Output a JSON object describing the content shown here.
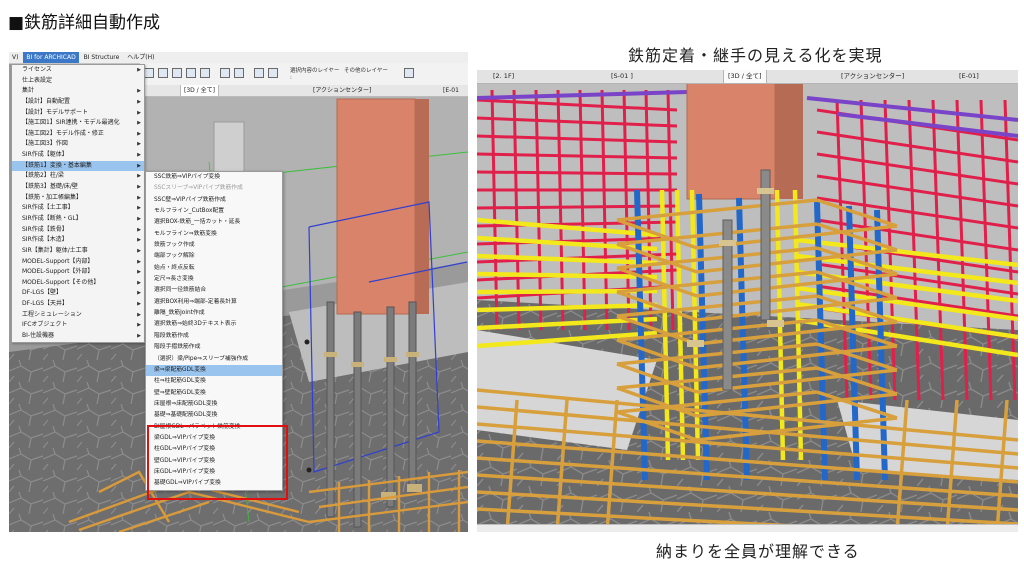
{
  "page": {
    "title": "■鉄筋詳細自動作成",
    "caption_top": "鉄筋定着・継手の見える化を実現",
    "caption_bottom": "納まりを全員が理解できる"
  },
  "left": {
    "menubar": [
      {
        "label": "V)"
      },
      {
        "label": "BI for ARCHICAD",
        "active": true
      },
      {
        "label": "BI Structure"
      },
      {
        "label": "ヘルプ(H)"
      }
    ],
    "toolbar": {
      "label1": "選択内容のレイヤー",
      "label2": "その他のレイヤー",
      "label3": ":"
    },
    "tabs": [
      {
        "label": "[3D / 全て]"
      },
      {
        "label": "[アクションセンター]"
      },
      {
        "label": "[E-01"
      }
    ],
    "menu": [
      {
        "label": "ライセンス",
        "arrow": true
      },
      {
        "label": "仕上表設定",
        "arrow": false
      },
      {
        "label": "集計",
        "arrow": true
      },
      {
        "label": "【設計】自動配置",
        "arrow": true
      },
      {
        "label": "【設計】モデルサポート",
        "arrow": true
      },
      {
        "label": "【施工図1】SIR連携・モデル最適化",
        "arrow": true
      },
      {
        "label": "【施工図2】モデル作成・修正",
        "arrow": true
      },
      {
        "label": "【施工図3】作図",
        "arrow": true
      },
      {
        "label": "SIR作成【躯体】",
        "arrow": true
      },
      {
        "label": "【鉄筋1】変換・基本編集",
        "arrow": true,
        "highlight": true
      },
      {
        "label": "【鉄筋2】柱/梁",
        "arrow": true
      },
      {
        "label": "【鉄筋3】基礎/床/壁",
        "arrow": true
      },
      {
        "label": "【鉄筋・加工帳編集】",
        "arrow": true
      },
      {
        "label": "SIR作成【土工事】",
        "arrow": true
      },
      {
        "label": "SIR作成【断熱・GL】",
        "arrow": true
      },
      {
        "label": "SIR作成【鉄骨】",
        "arrow": true
      },
      {
        "label": "SIR作成【木造】",
        "arrow": true
      },
      {
        "label": "SIR【集計】躯体/土工事",
        "arrow": true
      },
      {
        "label": "MODEL-Support【内部】",
        "arrow": true
      },
      {
        "label": "MODEL-Support【外部】",
        "arrow": true
      },
      {
        "label": "MODEL-Support【その他】",
        "arrow": true
      },
      {
        "label": "DF-LGS【壁】",
        "arrow": true
      },
      {
        "label": "DF-LGS【天井】",
        "arrow": true
      },
      {
        "label": "工程シミュレーション",
        "arrow": true
      },
      {
        "label": "IFCオブジェクト",
        "arrow": true
      },
      {
        "label": "BI-住設機器",
        "arrow": true
      }
    ],
    "submenu": [
      {
        "label": "SSC鉄筋⇒VIPパイプ変換"
      },
      {
        "label": "SSCスリーブ⇒VIPパイプ鉄筋作成",
        "dim": true
      },
      {
        "label": "SSC壁⇒VIPパイプ鉄筋作成"
      },
      {
        "label": "モルフライン_CutBox配置"
      },
      {
        "label": "選択BOX-鉄筋_一括カット・延長"
      },
      {
        "label": "モルフライン⇒鉄筋変換"
      },
      {
        "label": "鉄筋フック作成"
      },
      {
        "label": "端部フック解除"
      },
      {
        "label": "始点・終点反転"
      },
      {
        "label": "定尺⇒長さ変換"
      },
      {
        "label": "選択同一径鉄筋結合"
      },
      {
        "label": "選択BOX利用⇒端部-定着長計算"
      },
      {
        "label": "離隔_鉄筋Joint作成"
      },
      {
        "label": "選択鉄筋⇒始終3Dテキスト表示"
      },
      {
        "label": "階段鉄筋作成"
      },
      {
        "label": "階段手摺鉄筋作成"
      },
      {
        "label": "（選択）梁/Pipe⇒スリーブ補強作成"
      },
      {
        "label": "梁⇒梁配筋GDL変換",
        "highlight": true
      },
      {
        "label": "柱⇒柱配筋GDL変換"
      },
      {
        "label": "壁⇒壁配筋GDL変換"
      },
      {
        "label": "床屋根⇒床配筋GDL変換"
      },
      {
        "label": "基礎⇒基礎配筋GDL変換"
      },
      {
        "label": "BI屋根GDL⇒パラペット鉄筋変換"
      },
      {
        "label": "梁GDL⇒VIPパイプ変換"
      },
      {
        "label": "柱GDL⇒VIPパイプ変換"
      },
      {
        "label": "壁GDL⇒VIPパイプ変換"
      },
      {
        "label": "床GDL⇒VIPパイプ変換"
      },
      {
        "label": "基礎GDL⇒VIPパイプ変換"
      }
    ]
  },
  "right": {
    "tabs": [
      {
        "label": "[2. 1F]"
      },
      {
        "label": "[S-01 ]"
      },
      {
        "label": "[3D / 全て]",
        "active": true
      },
      {
        "label": "[アクションセンター]"
      },
      {
        "label": "[E-01]"
      }
    ]
  },
  "colors": {
    "highlight_box": "#e01010",
    "menu_highlight": "#99c4ee",
    "column_concrete": "#d9846a",
    "rebar_red": "#e0204a",
    "rebar_blue": "#2368c8",
    "rebar_yellow": "#f2e81c",
    "rebar_orange": "#d8a03c",
    "rebar_purple": "#7a44c8"
  }
}
